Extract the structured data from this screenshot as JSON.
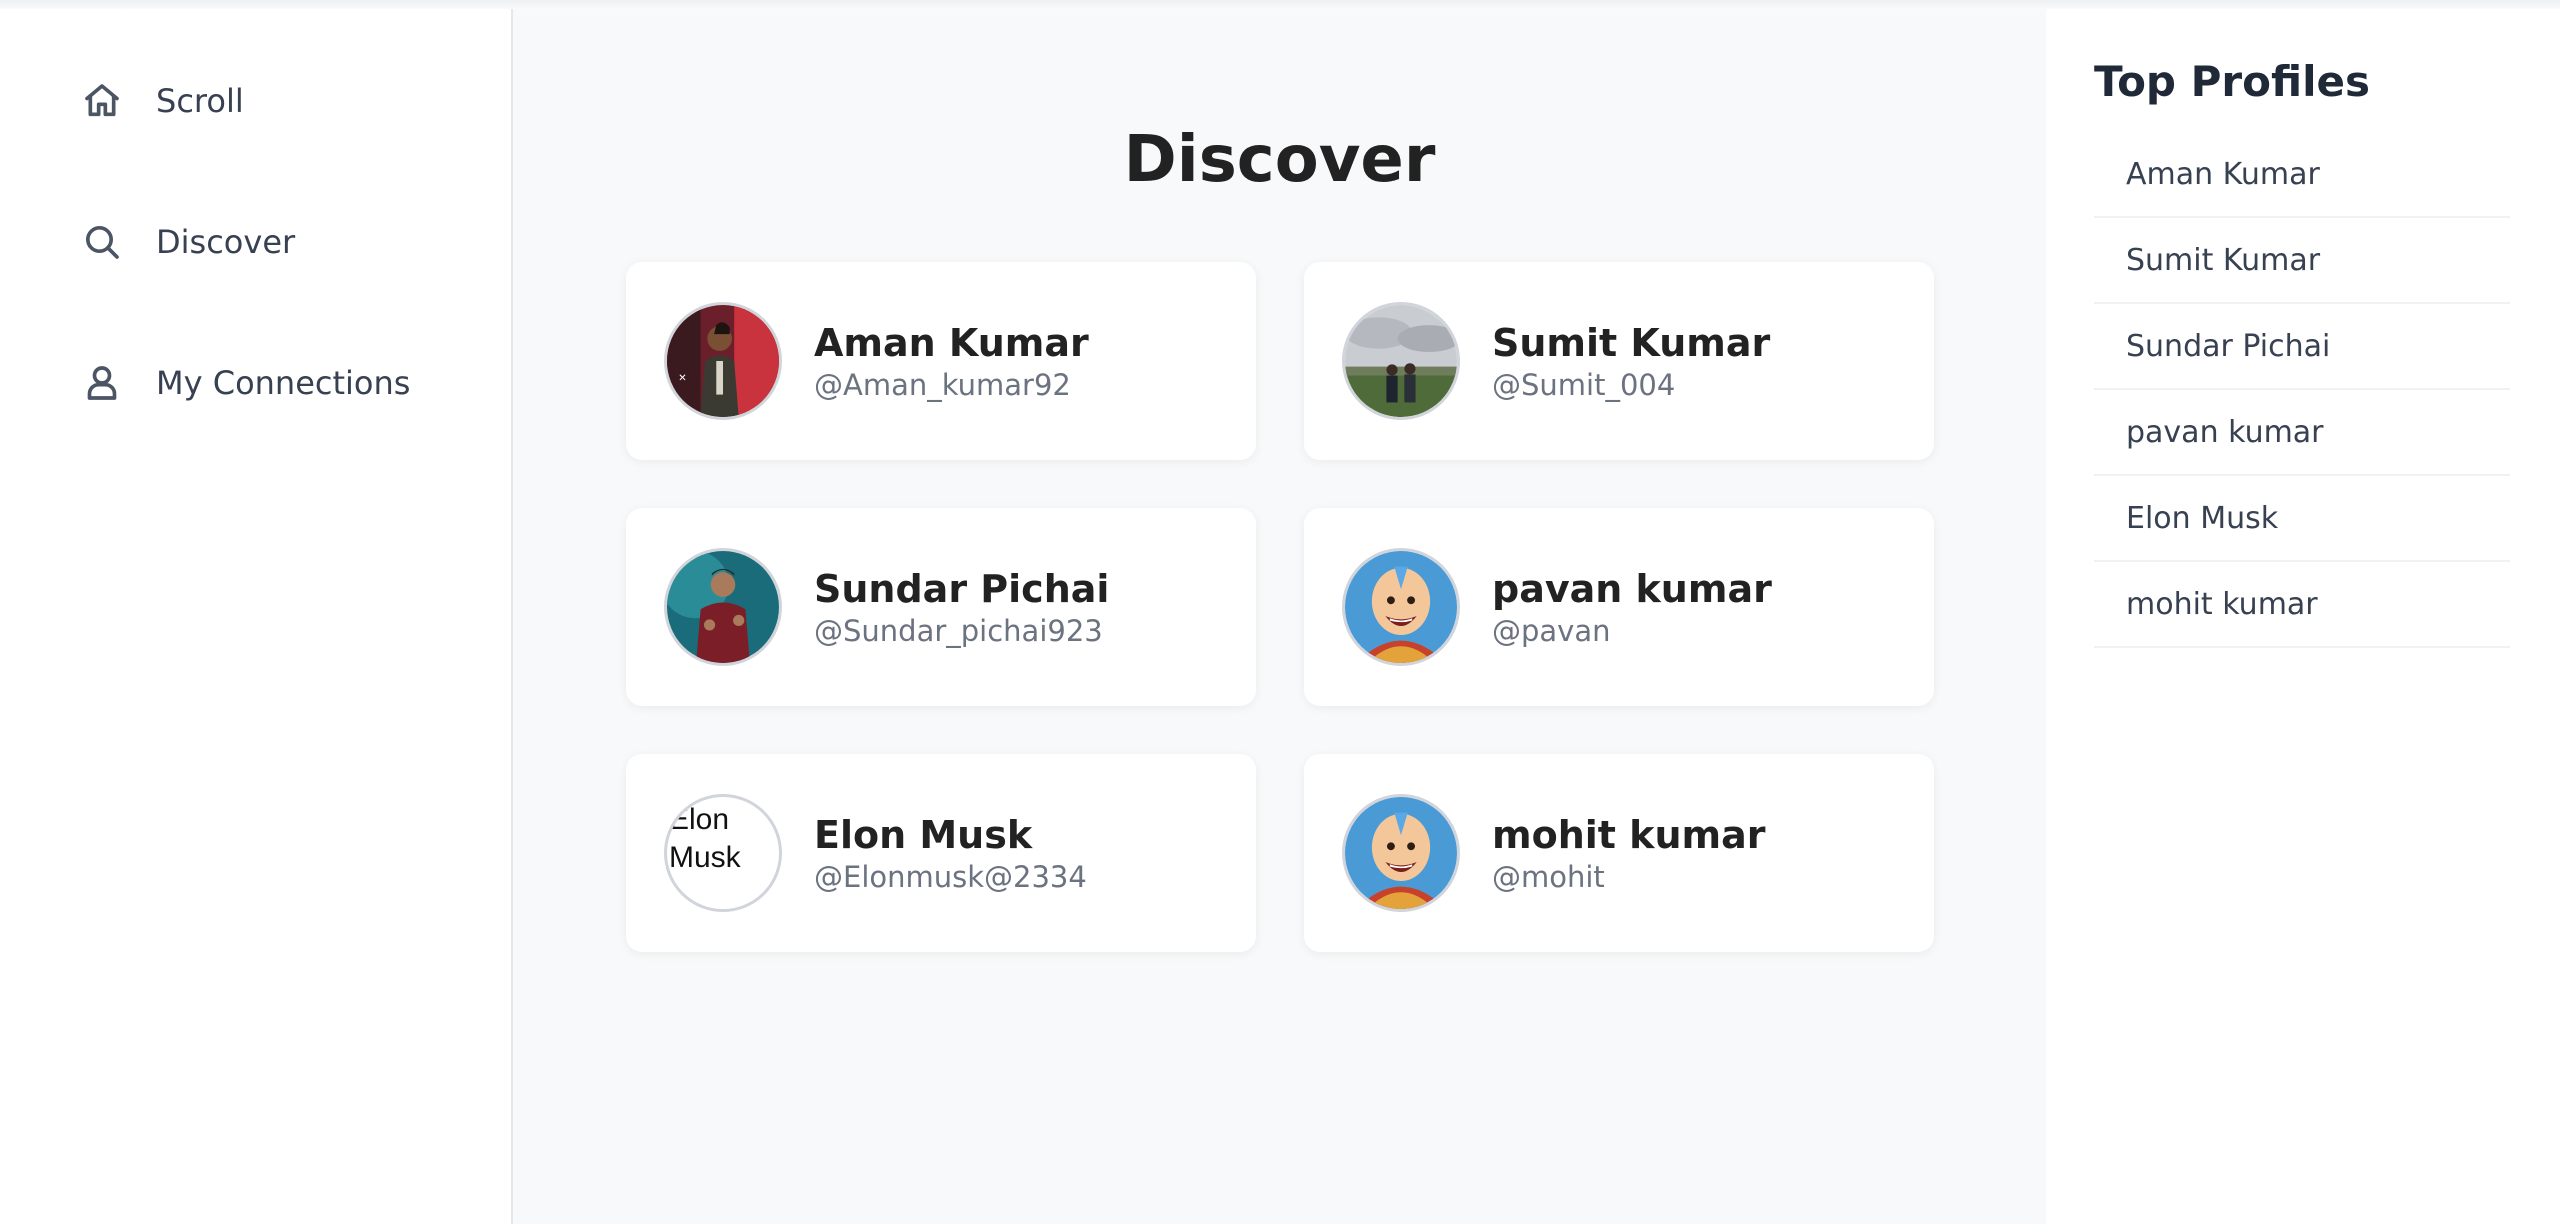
{
  "nav": {
    "items": [
      {
        "label": "Scroll",
        "icon": "home-icon"
      },
      {
        "label": "Discover",
        "icon": "search-icon"
      },
      {
        "label": "My Connections",
        "icon": "user-icon"
      }
    ]
  },
  "main": {
    "title": "Discover",
    "cards": [
      {
        "name": "Aman Kumar",
        "handle": "@Aman_kumar92",
        "avatar": "photo"
      },
      {
        "name": "Sumit Kumar",
        "handle": "@Sumit_004",
        "avatar": "photo"
      },
      {
        "name": "Sundar Pichai",
        "handle": "@Sundar_pichai923",
        "avatar": "photo"
      },
      {
        "name": "pavan kumar",
        "handle": "@pavan",
        "avatar": "cartoon"
      },
      {
        "name": "Elon Musk",
        "handle": "@Elonmusk@2334",
        "avatar": "broken",
        "alt": "Elon Musk"
      },
      {
        "name": "mohit kumar",
        "handle": "@mohit",
        "avatar": "cartoon"
      }
    ]
  },
  "right": {
    "title": "Top Profiles",
    "items": [
      "Aman Kumar",
      "Sumit Kumar",
      "Sundar Pichai",
      "pavan kumar",
      "Elon Musk",
      "mohit kumar"
    ]
  },
  "colors": {
    "main_bg": "#f8f9fa",
    "card_bg": "#ffffff",
    "text_dark": "#222222",
    "text_muted": "#6b7280"
  }
}
